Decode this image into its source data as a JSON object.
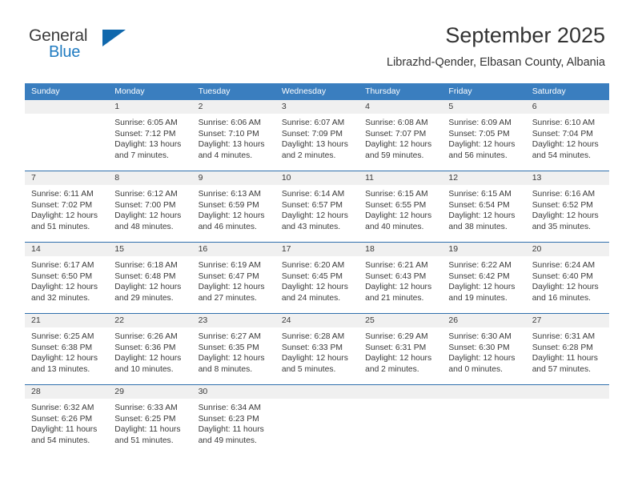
{
  "brand": {
    "name_top": "General",
    "name_bottom": "Blue",
    "accent_color": "#1f7bc1"
  },
  "header": {
    "title": "September 2025",
    "location": "Librazhd-Qender, Elbasan County, Albania"
  },
  "calendar": {
    "header_bg": "#3a7ebf",
    "row_divider_color": "#2f6fad",
    "daynumber_bg": "#f0f0f0",
    "weekdays": [
      "Sunday",
      "Monday",
      "Tuesday",
      "Wednesday",
      "Thursday",
      "Friday",
      "Saturday"
    ],
    "weeks": [
      [
        {
          "day": "",
          "lines": [
            "",
            "",
            "",
            ""
          ]
        },
        {
          "day": "1",
          "lines": [
            "Sunrise: 6:05 AM",
            "Sunset: 7:12 PM",
            "Daylight: 13 hours",
            "and 7 minutes."
          ]
        },
        {
          "day": "2",
          "lines": [
            "Sunrise: 6:06 AM",
            "Sunset: 7:10 PM",
            "Daylight: 13 hours",
            "and 4 minutes."
          ]
        },
        {
          "day": "3",
          "lines": [
            "Sunrise: 6:07 AM",
            "Sunset: 7:09 PM",
            "Daylight: 13 hours",
            "and 2 minutes."
          ]
        },
        {
          "day": "4",
          "lines": [
            "Sunrise: 6:08 AM",
            "Sunset: 7:07 PM",
            "Daylight: 12 hours",
            "and 59 minutes."
          ]
        },
        {
          "day": "5",
          "lines": [
            "Sunrise: 6:09 AM",
            "Sunset: 7:05 PM",
            "Daylight: 12 hours",
            "and 56 minutes."
          ]
        },
        {
          "day": "6",
          "lines": [
            "Sunrise: 6:10 AM",
            "Sunset: 7:04 PM",
            "Daylight: 12 hours",
            "and 54 minutes."
          ]
        }
      ],
      [
        {
          "day": "7",
          "lines": [
            "Sunrise: 6:11 AM",
            "Sunset: 7:02 PM",
            "Daylight: 12 hours",
            "and 51 minutes."
          ]
        },
        {
          "day": "8",
          "lines": [
            "Sunrise: 6:12 AM",
            "Sunset: 7:00 PM",
            "Daylight: 12 hours",
            "and 48 minutes."
          ]
        },
        {
          "day": "9",
          "lines": [
            "Sunrise: 6:13 AM",
            "Sunset: 6:59 PM",
            "Daylight: 12 hours",
            "and 46 minutes."
          ]
        },
        {
          "day": "10",
          "lines": [
            "Sunrise: 6:14 AM",
            "Sunset: 6:57 PM",
            "Daylight: 12 hours",
            "and 43 minutes."
          ]
        },
        {
          "day": "11",
          "lines": [
            "Sunrise: 6:15 AM",
            "Sunset: 6:55 PM",
            "Daylight: 12 hours",
            "and 40 minutes."
          ]
        },
        {
          "day": "12",
          "lines": [
            "Sunrise: 6:15 AM",
            "Sunset: 6:54 PM",
            "Daylight: 12 hours",
            "and 38 minutes."
          ]
        },
        {
          "day": "13",
          "lines": [
            "Sunrise: 6:16 AM",
            "Sunset: 6:52 PM",
            "Daylight: 12 hours",
            "and 35 minutes."
          ]
        }
      ],
      [
        {
          "day": "14",
          "lines": [
            "Sunrise: 6:17 AM",
            "Sunset: 6:50 PM",
            "Daylight: 12 hours",
            "and 32 minutes."
          ]
        },
        {
          "day": "15",
          "lines": [
            "Sunrise: 6:18 AM",
            "Sunset: 6:48 PM",
            "Daylight: 12 hours",
            "and 29 minutes."
          ]
        },
        {
          "day": "16",
          "lines": [
            "Sunrise: 6:19 AM",
            "Sunset: 6:47 PM",
            "Daylight: 12 hours",
            "and 27 minutes."
          ]
        },
        {
          "day": "17",
          "lines": [
            "Sunrise: 6:20 AM",
            "Sunset: 6:45 PM",
            "Daylight: 12 hours",
            "and 24 minutes."
          ]
        },
        {
          "day": "18",
          "lines": [
            "Sunrise: 6:21 AM",
            "Sunset: 6:43 PM",
            "Daylight: 12 hours",
            "and 21 minutes."
          ]
        },
        {
          "day": "19",
          "lines": [
            "Sunrise: 6:22 AM",
            "Sunset: 6:42 PM",
            "Daylight: 12 hours",
            "and 19 minutes."
          ]
        },
        {
          "day": "20",
          "lines": [
            "Sunrise: 6:24 AM",
            "Sunset: 6:40 PM",
            "Daylight: 12 hours",
            "and 16 minutes."
          ]
        }
      ],
      [
        {
          "day": "21",
          "lines": [
            "Sunrise: 6:25 AM",
            "Sunset: 6:38 PM",
            "Daylight: 12 hours",
            "and 13 minutes."
          ]
        },
        {
          "day": "22",
          "lines": [
            "Sunrise: 6:26 AM",
            "Sunset: 6:36 PM",
            "Daylight: 12 hours",
            "and 10 minutes."
          ]
        },
        {
          "day": "23",
          "lines": [
            "Sunrise: 6:27 AM",
            "Sunset: 6:35 PM",
            "Daylight: 12 hours",
            "and 8 minutes."
          ]
        },
        {
          "day": "24",
          "lines": [
            "Sunrise: 6:28 AM",
            "Sunset: 6:33 PM",
            "Daylight: 12 hours",
            "and 5 minutes."
          ]
        },
        {
          "day": "25",
          "lines": [
            "Sunrise: 6:29 AM",
            "Sunset: 6:31 PM",
            "Daylight: 12 hours",
            "and 2 minutes."
          ]
        },
        {
          "day": "26",
          "lines": [
            "Sunrise: 6:30 AM",
            "Sunset: 6:30 PM",
            "Daylight: 12 hours",
            "and 0 minutes."
          ]
        },
        {
          "day": "27",
          "lines": [
            "Sunrise: 6:31 AM",
            "Sunset: 6:28 PM",
            "Daylight: 11 hours",
            "and 57 minutes."
          ]
        }
      ],
      [
        {
          "day": "28",
          "lines": [
            "Sunrise: 6:32 AM",
            "Sunset: 6:26 PM",
            "Daylight: 11 hours",
            "and 54 minutes."
          ]
        },
        {
          "day": "29",
          "lines": [
            "Sunrise: 6:33 AM",
            "Sunset: 6:25 PM",
            "Daylight: 11 hours",
            "and 51 minutes."
          ]
        },
        {
          "day": "30",
          "lines": [
            "Sunrise: 6:34 AM",
            "Sunset: 6:23 PM",
            "Daylight: 11 hours",
            "and 49 minutes."
          ]
        },
        {
          "day": "",
          "lines": [
            "",
            "",
            "",
            ""
          ]
        },
        {
          "day": "",
          "lines": [
            "",
            "",
            "",
            ""
          ]
        },
        {
          "day": "",
          "lines": [
            "",
            "",
            "",
            ""
          ]
        },
        {
          "day": "",
          "lines": [
            "",
            "",
            "",
            ""
          ]
        }
      ]
    ]
  }
}
